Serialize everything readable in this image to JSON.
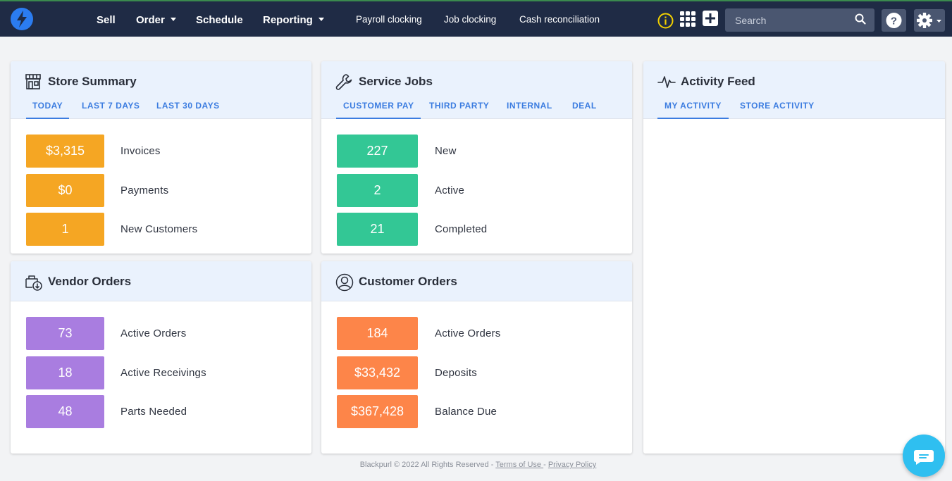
{
  "nav": {
    "items": [
      {
        "label": "Sell",
        "caret": false
      },
      {
        "label": "Order",
        "caret": true
      },
      {
        "label": "Schedule",
        "caret": false
      },
      {
        "label": "Reporting",
        "caret": true
      }
    ],
    "sub_links": [
      "Payroll clocking",
      "Job clocking",
      "Cash reconciliation"
    ],
    "search_placeholder": "Search",
    "icons": [
      "info-icon",
      "apps-grid-icon",
      "add-icon",
      "search-icon",
      "help-icon",
      "gear-icon"
    ]
  },
  "store_summary": {
    "title": "Store Summary",
    "tabs": [
      "TODAY",
      "LAST 7 DAYS",
      "LAST 30 DAYS"
    ],
    "active_tab": "TODAY",
    "color": "#f5a623",
    "stats": [
      {
        "value": "$3,315",
        "label": "Invoices"
      },
      {
        "value": "$0",
        "label": "Payments"
      },
      {
        "value": "1",
        "label": "New Customers"
      }
    ]
  },
  "service_jobs": {
    "title": "Service Jobs",
    "tabs": [
      "CUSTOMER PAY",
      "THIRD PARTY",
      "INTERNAL",
      "DEAL"
    ],
    "active_tab": "CUSTOMER PAY",
    "color": "#33c795",
    "stats": [
      {
        "value": "227",
        "label": "New"
      },
      {
        "value": "2",
        "label": "Active"
      },
      {
        "value": "21",
        "label": "Completed"
      }
    ]
  },
  "activity_feed": {
    "title": "Activity Feed",
    "tabs": [
      "MY ACTIVITY",
      "STORE ACTIVITY"
    ],
    "active_tab": "MY ACTIVITY"
  },
  "vendor_orders": {
    "title": "Vendor Orders",
    "color": "#a97de0",
    "stats": [
      {
        "value": "73",
        "label": "Active Orders"
      },
      {
        "value": "18",
        "label": "Active Receivings"
      },
      {
        "value": "48",
        "label": "Parts Needed"
      }
    ]
  },
  "customer_orders": {
    "title": "Customer Orders",
    "color": "#fd8549",
    "stats": [
      {
        "value": "184",
        "label": "Active Orders"
      },
      {
        "value": "$33,432",
        "label": "Deposits"
      },
      {
        "value": "$367,428",
        "label": "Balance Due"
      }
    ]
  },
  "footer": {
    "text": "Blackpurl © 2022 All Rights Reserved - ",
    "terms": "Terms of Use ",
    "sep": " - ",
    "privacy": "Privacy Policy"
  }
}
